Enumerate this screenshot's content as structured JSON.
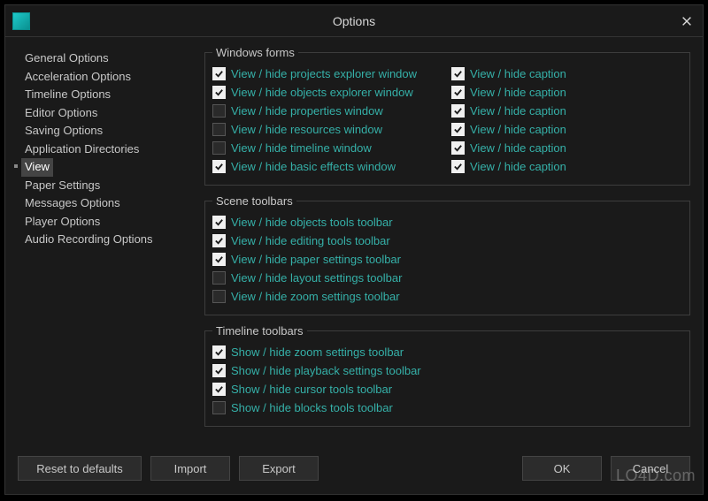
{
  "title": "Options",
  "sidebar": {
    "items": [
      {
        "label": "General Options"
      },
      {
        "label": "Acceleration Options"
      },
      {
        "label": "Timeline Options"
      },
      {
        "label": "Editor Options"
      },
      {
        "label": "Saving Options"
      },
      {
        "label": "Application Directories"
      },
      {
        "label": "View",
        "selected": true
      },
      {
        "label": "Paper Settings"
      },
      {
        "label": "Messages Options"
      },
      {
        "label": "Player Options"
      },
      {
        "label": "Audio Recording Options"
      }
    ]
  },
  "groups": {
    "windows_forms": {
      "legend": "Windows forms",
      "left": [
        {
          "label": "View / hide projects explorer window",
          "checked": true
        },
        {
          "label": "View / hide objects explorer window",
          "checked": true
        },
        {
          "label": "View / hide properties window",
          "checked": false
        },
        {
          "label": "View / hide resources window",
          "checked": false
        },
        {
          "label": "View / hide timeline window",
          "checked": false
        },
        {
          "label": "View / hide basic effects window",
          "checked": true
        }
      ],
      "right": [
        {
          "label": "View / hide caption",
          "checked": true
        },
        {
          "label": "View / hide caption",
          "checked": true
        },
        {
          "label": "View / hide caption",
          "checked": true
        },
        {
          "label": "View / hide caption",
          "checked": true
        },
        {
          "label": "View / hide caption",
          "checked": true
        },
        {
          "label": "View / hide caption",
          "checked": true
        }
      ]
    },
    "scene_toolbars": {
      "legend": "Scene toolbars",
      "items": [
        {
          "label": "View / hide objects tools toolbar",
          "checked": true
        },
        {
          "label": "View / hide editing tools toolbar",
          "checked": true
        },
        {
          "label": "View / hide paper settings toolbar",
          "checked": true
        },
        {
          "label": "View / hide layout settings toolbar",
          "checked": false
        },
        {
          "label": "View / hide zoom settings toolbar",
          "checked": false
        }
      ]
    },
    "timeline_toolbars": {
      "legend": "Timeline toolbars",
      "items": [
        {
          "label": "Show / hide zoom settings toolbar",
          "checked": true
        },
        {
          "label": "Show / hide playback settings toolbar",
          "checked": true
        },
        {
          "label": "Show / hide cursor tools toolbar",
          "checked": true
        },
        {
          "label": "Show / hide blocks tools toolbar",
          "checked": false
        }
      ]
    }
  },
  "footer": {
    "reset": "Reset to defaults",
    "import": "Import",
    "export": "Export",
    "ok": "OK",
    "cancel": "Cancel"
  },
  "watermark": "LO4D.com"
}
